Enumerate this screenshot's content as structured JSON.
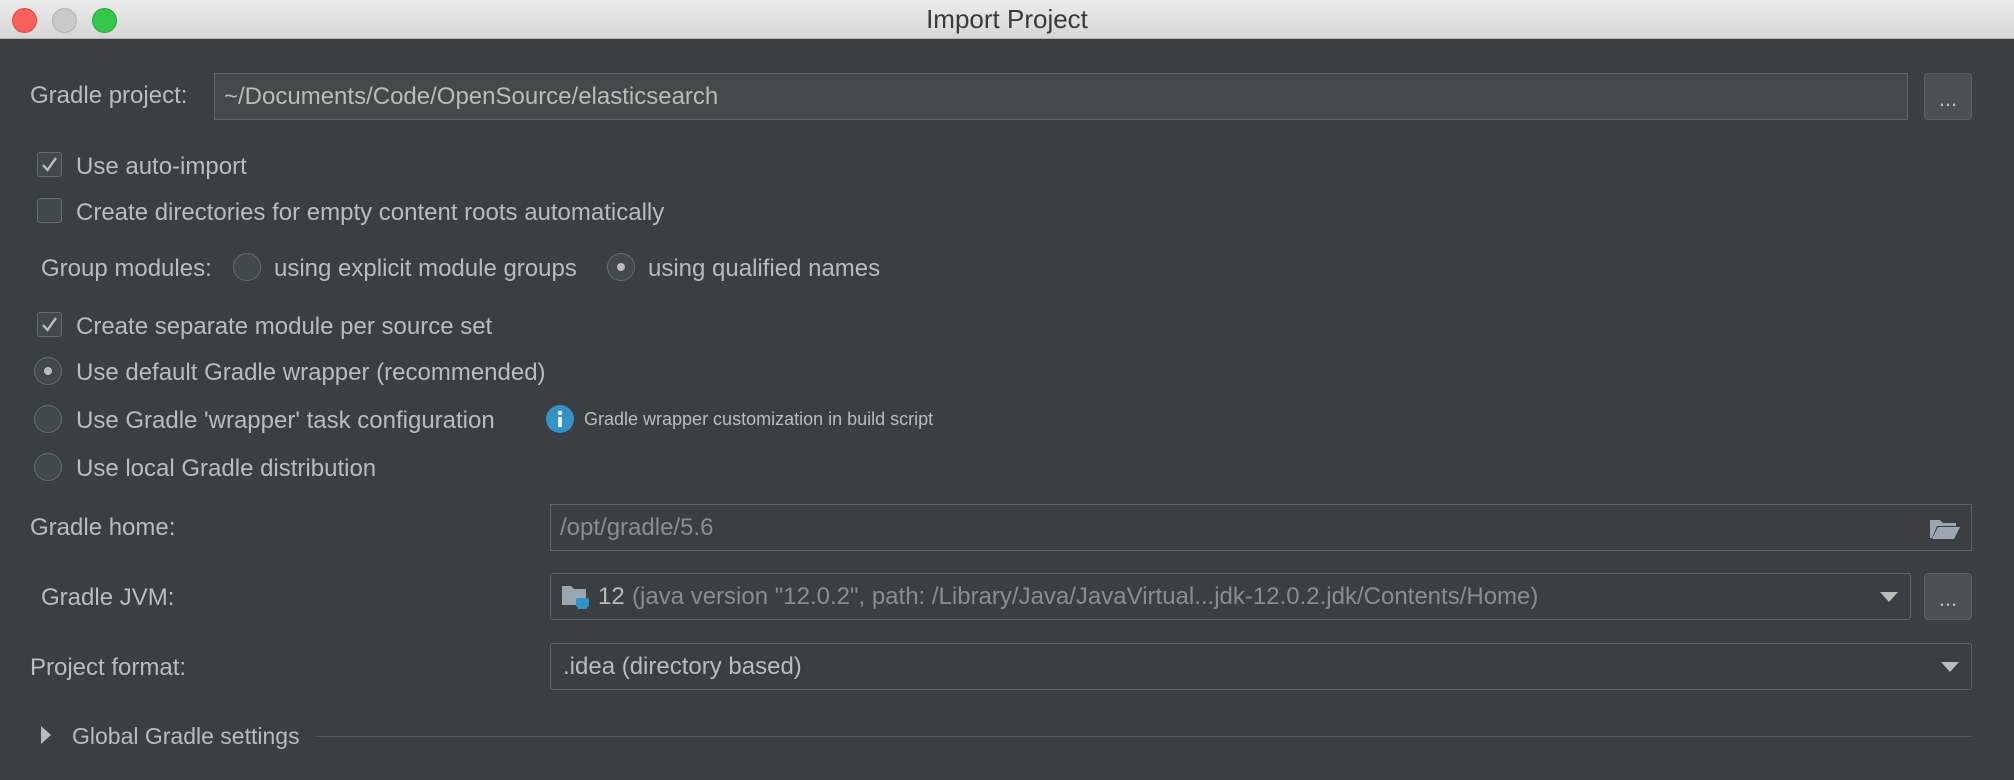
{
  "window": {
    "title": "Import Project"
  },
  "gradle_project": {
    "label": "Gradle project:",
    "value": "~/Documents/Code/OpenSource/elasticsearch",
    "browse_label": "..."
  },
  "options": {
    "auto_import": {
      "label": "Use auto-import",
      "checked": true
    },
    "create_dirs": {
      "label": "Create directories for empty content roots automatically",
      "checked": false
    },
    "group_modules": {
      "label": "Group modules:",
      "option_explicit": "using explicit module groups",
      "option_qualified": "using qualified names",
      "selected": "using qualified names"
    },
    "separate_module": {
      "label": "Create separate module per source set",
      "checked": true
    }
  },
  "gradle_distribution": {
    "default_wrapper": {
      "label": "Use default Gradle wrapper (recommended)",
      "selected": true
    },
    "wrapper_task": {
      "label": "Use Gradle 'wrapper' task configuration",
      "selected": false
    },
    "info_text": "Gradle wrapper customization in build script",
    "local_distribution": {
      "label": "Use local Gradle distribution",
      "selected": false
    }
  },
  "gradle_home": {
    "label": "Gradle home:",
    "value": "/opt/gradle/5.6"
  },
  "gradle_jvm": {
    "label": "Gradle JVM:",
    "version": "12",
    "detail": "(java version \"12.0.2\", path: /Library/Java/JavaVirtual...jdk-12.0.2.jdk/Contents/Home)",
    "browse_label": "..."
  },
  "project_format": {
    "label": "Project format:",
    "value": ".idea (directory based)"
  },
  "global_settings": {
    "label": "Global Gradle settings"
  },
  "colors": {
    "background": "#3c3f41",
    "text": "#bbbbbb",
    "field": "#45494a",
    "info_icon": "#3592c4"
  }
}
